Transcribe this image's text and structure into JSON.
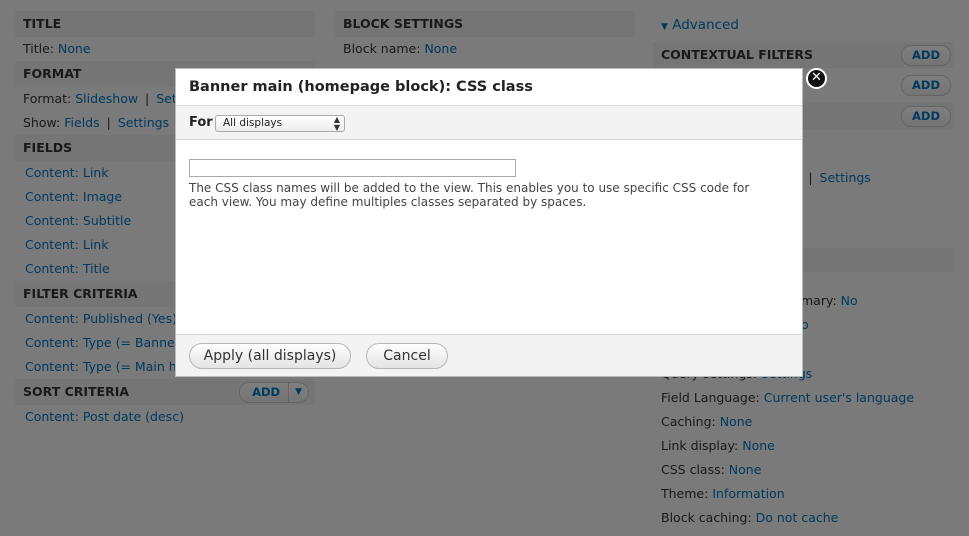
{
  "left": {
    "title_head": "TITLE",
    "title_label": "Title:",
    "title_value": "None",
    "format_head": "FORMAT",
    "format_label": "Format:",
    "format_value": "Slideshow",
    "format_sep": "|",
    "format_settings": "Sett",
    "show_label": "Show:",
    "show_value": "Fields",
    "show_sep": "|",
    "show_settings": "Settings",
    "fields_head": "FIELDS",
    "fields": [
      "Content: Link",
      "Content: Image",
      "Content: Subtitle",
      "Content: Link",
      "Content: Title"
    ],
    "filter_head": "FILTER CRITERIA",
    "filters": [
      "Content: Published (Yes)",
      "Content: Type (= Banner)",
      "Content: Type (= Main homepage)"
    ],
    "sort_head": "SORT CRITERIA",
    "sort_add": "Add",
    "sorts": [
      "Content: Post date (desc)"
    ]
  },
  "middle": {
    "block_head": "BLOCK SETTINGS",
    "block_name_label": "Block name:",
    "block_name_value": "None"
  },
  "right": {
    "advanced": "Advanced",
    "contextual_head": "CONTEXTUAL FILTERS",
    "add1": "Add",
    "add2": "Add",
    "partial_r": "R",
    "add3": "Add",
    "partial_ic": "ic",
    "partial_sep": "|",
    "settings": "Settings",
    "partial_summary_label": "mary:",
    "partial_summary_value": "No",
    "partial_o": "o",
    "query_label": "Query settings:",
    "query_value": "Settings",
    "field_language_label": "Field Language:",
    "field_language_value": "Current user's language",
    "caching_label": "Caching:",
    "caching_value": "None",
    "link_display_label": "Link display:",
    "link_display_value": "None",
    "css_class_label": "CSS class:",
    "css_class_value": "None",
    "theme_label": "Theme:",
    "theme_value": "Information",
    "block_caching_label": "Block caching:",
    "block_caching_value": "Do not cache"
  },
  "dialog": {
    "title": "Banner main (homepage block): CSS class",
    "for_label": "For",
    "for_select": "All displays",
    "input_value": "",
    "description": "The CSS class names will be added to the view. This enables you to use specific CSS code for each view. You may define multiples classes separated by spaces.",
    "apply_label": "Apply (all displays)",
    "cancel_label": "Cancel",
    "close_icon": "close-icon"
  }
}
